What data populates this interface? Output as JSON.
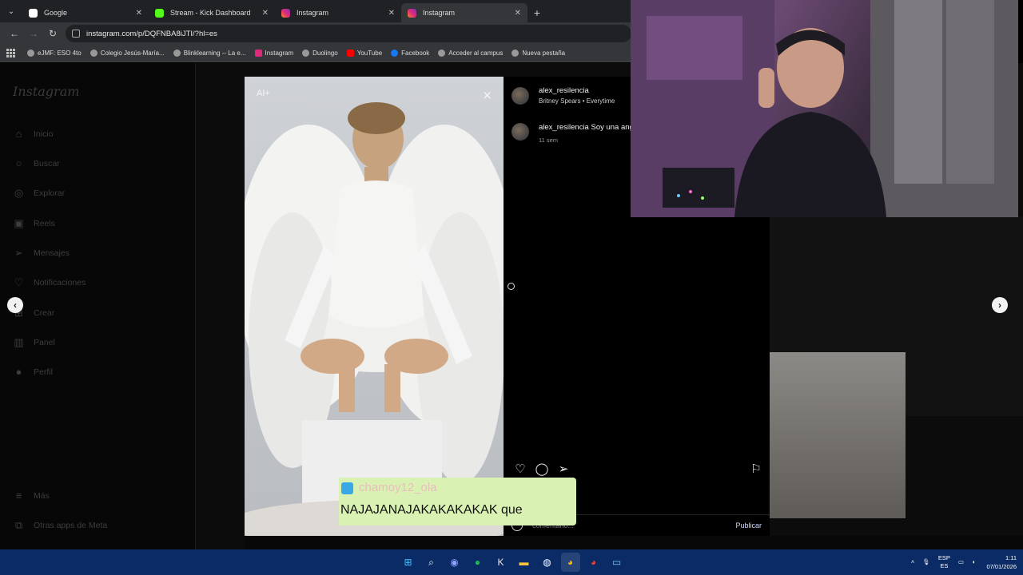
{
  "browser": {
    "tabs": [
      {
        "title": "Google",
        "color": "#4285f4"
      },
      {
        "title": "Stream - Kick Dashboard",
        "color": "#53fc18"
      },
      {
        "title": "Instagram",
        "color": "#e1306c"
      },
      {
        "title": "Instagram",
        "color": "#e1306c"
      }
    ],
    "url": "instagram.com/p/DQFNBA8iJTI/?hl=es",
    "bookmarks": [
      "eJMF: ESO 4to",
      "Colegio Jesús-María...",
      "Blinklearning -- La e...",
      "Instagram",
      "Duolingo",
      "YouTube",
      "Facebook",
      "Acceder al campus",
      "Nueva pestaña"
    ]
  },
  "sidebar": {
    "logo": "Instagram",
    "items": [
      {
        "label": "Inicio",
        "icon": "home-icon"
      },
      {
        "label": "Buscar",
        "icon": "search-icon"
      },
      {
        "label": "Explorar",
        "icon": "compass-icon"
      },
      {
        "label": "Reels",
        "icon": "reels-icon"
      },
      {
        "label": "Mensajes",
        "icon": "messages-icon"
      },
      {
        "label": "Notificaciones",
        "icon": "heart-icon"
      },
      {
        "label": "Crear",
        "icon": "plus-icon"
      },
      {
        "label": "Panel",
        "icon": "chart-icon"
      },
      {
        "label": "Perfil",
        "icon": "avatar-icon"
      }
    ],
    "bottom_items": [
      {
        "label": "Más",
        "icon": "menu-icon"
      },
      {
        "label": "Otras apps de Meta",
        "icon": "meta-icon"
      }
    ]
  },
  "post": {
    "ai_label": "AI+",
    "author": "alex_resilencia",
    "audio": "Britney Spears • Everytime",
    "comment_author": "alex_resilencia",
    "comment_text": "Soy una ang",
    "comment_time": "11 sem",
    "comment_placeholder": "comentario...",
    "publish_label": "Publicar"
  },
  "chat_overlay": {
    "username": "chamoy12_ola",
    "message": "NAJAJANAJAKAKAKAKAK que"
  },
  "taskbar": {
    "lang_top": "ESP",
    "lang_bottom": "ES",
    "time": "1:11",
    "date": "07/01/2026"
  }
}
